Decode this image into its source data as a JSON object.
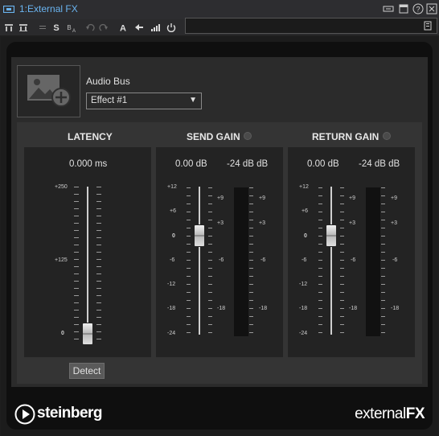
{
  "window": {
    "title": "1:External FX"
  },
  "toolbar": {
    "icons": [
      "io-icon",
      "io-alt-icon",
      "separator",
      "compare-icon",
      "split-icon",
      "undo-icon",
      "redo-icon",
      "a-icon",
      "arrow-left-icon",
      "meter-icon",
      "power-icon"
    ]
  },
  "audio_bus": {
    "label": "Audio Bus",
    "selected": "Effect #1"
  },
  "latency": {
    "title": "LATENCY",
    "value": "0.000 ms",
    "scale": [
      "+250",
      "+125",
      "0"
    ],
    "fader_level": 0,
    "detect_label": "Detect"
  },
  "send_gain": {
    "title": "SEND GAIN",
    "value": "0.00 dB",
    "peak": "-24 dB dB",
    "scale_left": [
      "+12",
      "+6",
      "0",
      "-6",
      "-12",
      "-18",
      "-24"
    ],
    "scale_right": [
      "+9",
      "+3",
      "-6",
      "-18"
    ]
  },
  "return_gain": {
    "title": "RETURN GAIN",
    "value": "0.00 dB",
    "peak": "-24 dB dB",
    "scale_left": [
      "+12",
      "+6",
      "0",
      "-6",
      "-12",
      "-18",
      "-24"
    ],
    "scale_right": [
      "+9",
      "+3",
      "-6",
      "-18"
    ]
  },
  "branding": {
    "company": "steinberg",
    "product_prefix": "external",
    "product_suffix": "FX"
  }
}
